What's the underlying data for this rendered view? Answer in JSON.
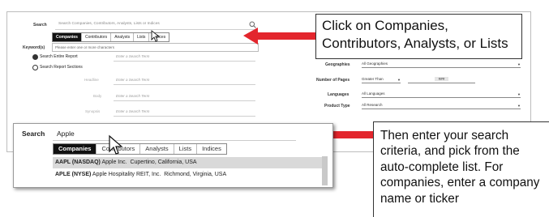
{
  "left_form": {
    "search_label": "Search",
    "search_placeholder": "Search Companies, Contributors, Analysts, Lists or Indices",
    "tabs": [
      "Companies",
      "Contributors",
      "Analysts",
      "Lists",
      "Indices"
    ],
    "keywords_label": "Keyword(s)",
    "hint": "Please enter one or more characters",
    "radio_entire": "Search Entire Report",
    "radio_sections": "Search Report Sections",
    "enter_term": "Enter a Search Term",
    "sections": [
      "Headline",
      "Body",
      "Synopsis"
    ]
  },
  "right_form": {
    "geographies_label": "Geographies",
    "geographies_value": "All Geographies",
    "pages_label": "Number of Pages",
    "pages_value": "Greater Than",
    "pages_number": "###",
    "languages_label": "Languages",
    "languages_value": "All Languages",
    "product_label": "Product Type",
    "product_value": "All Research"
  },
  "callout1": "Click on Companies, Contributors, Analysts, or Lists",
  "callout2": "Then enter your search criteria, and pick from the auto-complete list.  For companies, enter a company name or ticker",
  "zoom": {
    "search_label": "Search",
    "search_value": "Apple",
    "tabs": [
      "Companies",
      "Contributors",
      "Analysts",
      "Lists",
      "Indices"
    ],
    "results": [
      {
        "ticker": "AAPL (NASDAQ)",
        "name": "Apple Inc.",
        "location": "Cupertino, California, USA"
      },
      {
        "ticker": "APLE (NYSE)",
        "name": "Apple Hospitality REIT, Inc.",
        "location": "Richmond, Virginia, USA"
      }
    ]
  },
  "colors": {
    "arrow": "#e3262d",
    "active_tab": "#111111"
  }
}
